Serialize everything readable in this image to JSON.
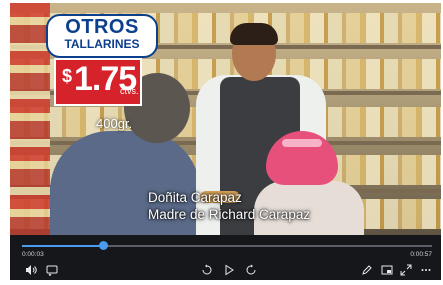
{
  "promo": {
    "brand_line1": "OTROS",
    "brand_line2": "TALLARINES",
    "currency": "$",
    "price": "1.75",
    "price_unit": "ctvs.",
    "weight": "400gr."
  },
  "caption": {
    "line1": "Doñita Carapaz",
    "line2": "Madre de Richard Carapaz"
  },
  "player": {
    "time_elapsed": "0:00:03",
    "time_remaining": "0:00:57",
    "progress": 0.2
  },
  "colors": {
    "accent": "#4a9cf0",
    "price_tag": "#d6222b",
    "brand_blue": "#0c3f8c"
  },
  "icons": {
    "volume": "volume-icon",
    "captions": "captions-icon",
    "rewind": "rewind-10-icon",
    "play": "play-icon",
    "forward": "forward-30-icon",
    "edit": "pen-icon",
    "miniview": "miniview-icon",
    "fullscreen": "fullscreen-icon",
    "more": "more-icon"
  }
}
